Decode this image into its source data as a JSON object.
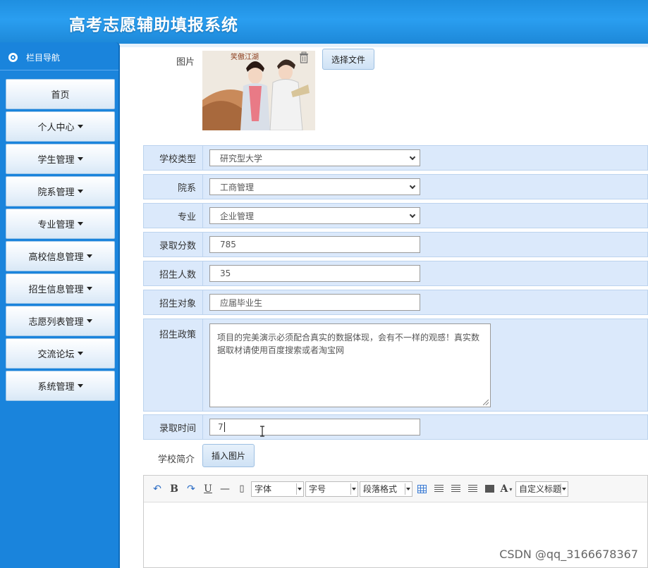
{
  "header": {
    "title": "高考志愿辅助填报系统"
  },
  "sidebar": {
    "heading": "栏目导航",
    "items": [
      {
        "label": "首页",
        "has_caret": false
      },
      {
        "label": "个人中心",
        "has_caret": true
      },
      {
        "label": "学生管理",
        "has_caret": true
      },
      {
        "label": "院系管理",
        "has_caret": true
      },
      {
        "label": "专业管理",
        "has_caret": true
      },
      {
        "label": "高校信息管理",
        "has_caret": true
      },
      {
        "label": "招生信息管理",
        "has_caret": true
      },
      {
        "label": "志愿列表管理",
        "has_caret": true
      },
      {
        "label": "交流论坛",
        "has_caret": true
      },
      {
        "label": "系统管理",
        "has_caret": true
      }
    ]
  },
  "form": {
    "image": {
      "label": "图片",
      "choose_file": "选择文件",
      "image_caption": "笑傲江湖"
    },
    "school_type": {
      "label": "学校类型",
      "value": "研究型大学"
    },
    "department": {
      "label": "院系",
      "value": "工商管理"
    },
    "major": {
      "label": "专业",
      "value": "企业管理"
    },
    "admission_score": {
      "label": "录取分数",
      "value": "785"
    },
    "enrollment": {
      "label": "招生人数",
      "value": "35"
    },
    "target": {
      "label": "招生对象",
      "value": "应届毕业生"
    },
    "policy": {
      "label": "招生政策",
      "value": "项目的完美演示必须配合真实的数据体现，会有不一样的观感！真实数据取材请使用百度搜索或者淘宝网"
    },
    "admission_time": {
      "label": "录取时间",
      "value": "7"
    },
    "intro": {
      "label": "学校简介",
      "insert_image": "插入图片"
    }
  },
  "editor": {
    "font": "字体",
    "size": "字号",
    "paragraph": "段落格式",
    "custom_title": "自定义标题"
  },
  "watermark": "CSDN @qq_3166678367"
}
